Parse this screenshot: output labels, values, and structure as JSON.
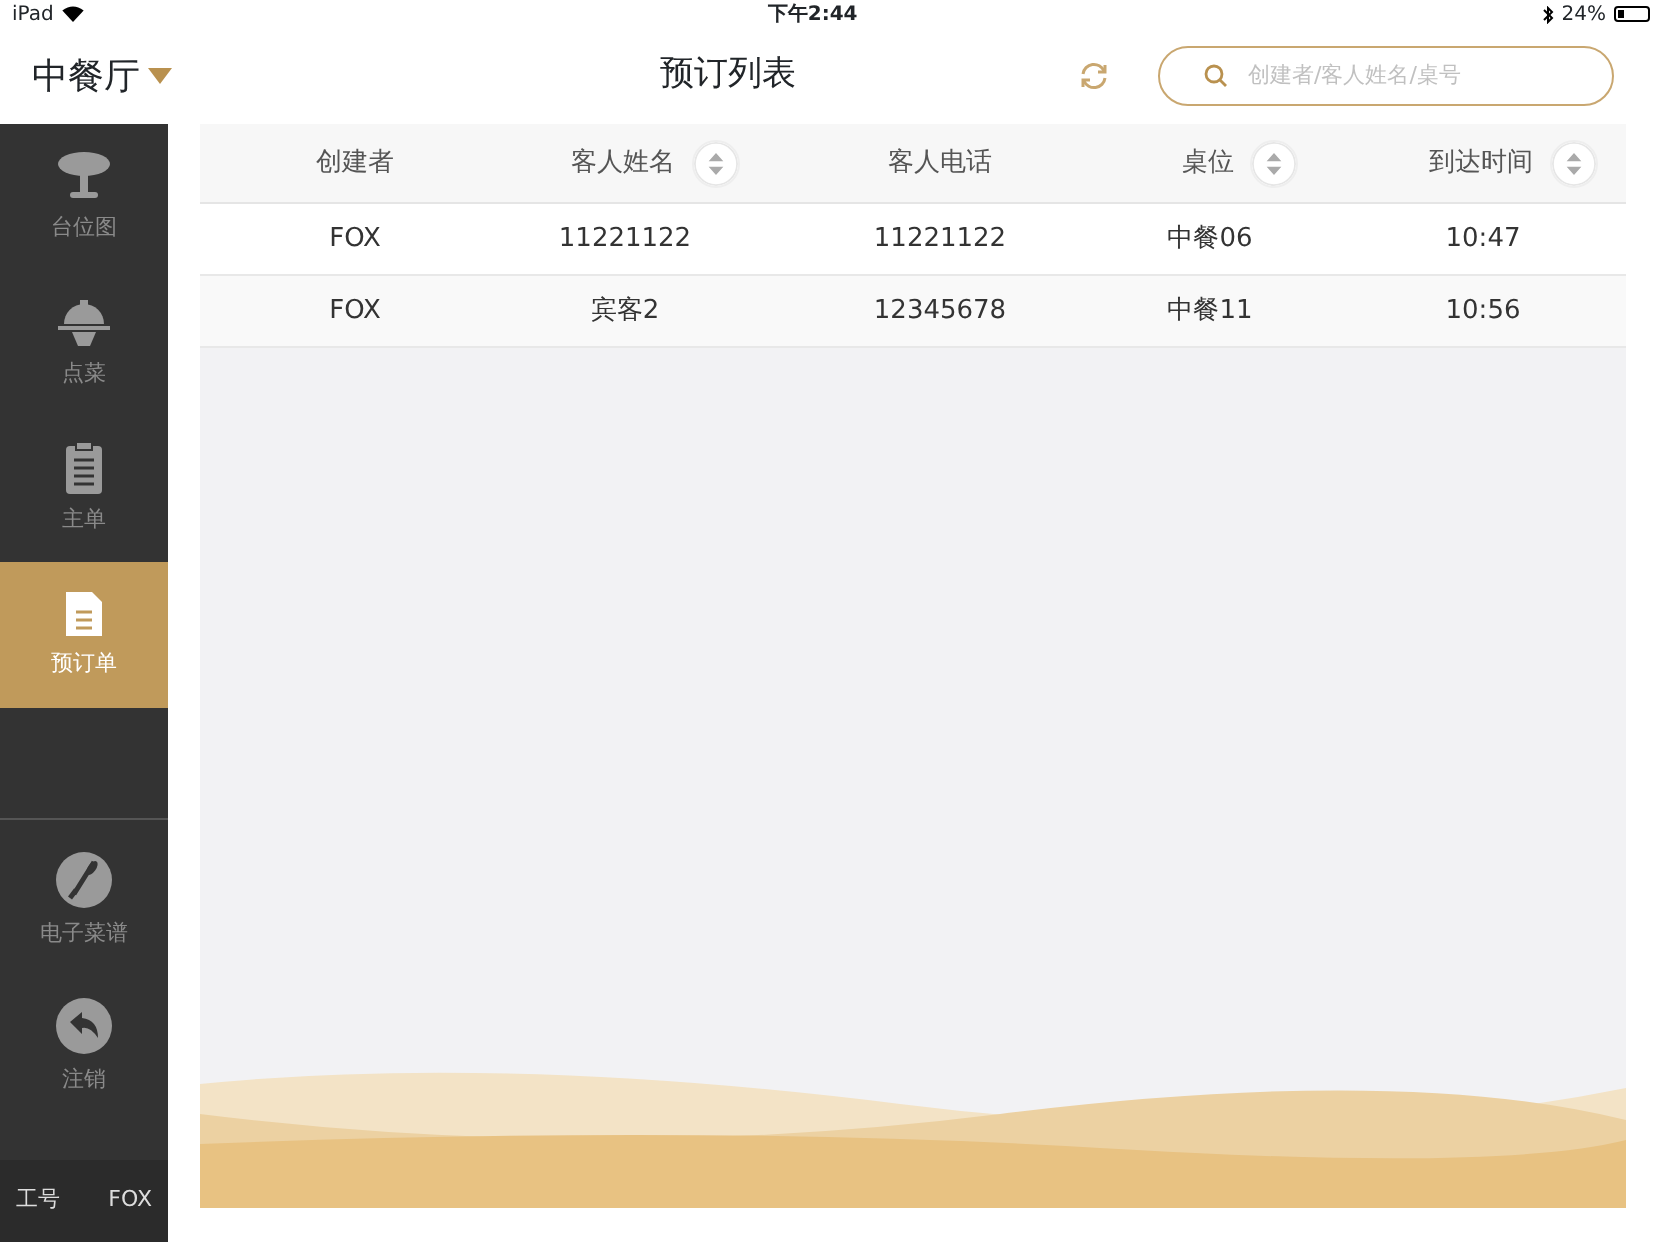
{
  "status_bar": {
    "device": "iPad",
    "time": "下午2:44",
    "battery": "24%"
  },
  "header": {
    "venue": "中餐厅",
    "title": "预订列表",
    "search": {
      "placeholder": "创建者/客人姓名/桌号"
    }
  },
  "sidebar": {
    "items": [
      {
        "label": "台位图",
        "kind": "table",
        "selected": false
      },
      {
        "label": "点菜",
        "kind": "cloche",
        "selected": false
      },
      {
        "label": "主单",
        "kind": "clipboard",
        "selected": false
      },
      {
        "label": "预订单",
        "kind": "document",
        "selected": true
      }
    ],
    "bottom_items": [
      {
        "label": "电子菜谱",
        "kind": "utensils"
      },
      {
        "label": "注销",
        "kind": "back"
      }
    ],
    "footer": {
      "label": "工号",
      "value": "FOX"
    }
  },
  "table": {
    "columns": [
      {
        "label": "创建者",
        "sortable": false
      },
      {
        "label": "客人姓名",
        "sortable": true
      },
      {
        "label": "客人电话",
        "sortable": false
      },
      {
        "label": "桌位",
        "sortable": true
      },
      {
        "label": "到达时间",
        "sortable": true
      }
    ],
    "rows": [
      [
        "FOX",
        "11221122",
        "11221122",
        "中餐06",
        "10:47"
      ],
      [
        "FOX",
        "宾客2",
        "12345678",
        "中餐11",
        "10:56"
      ]
    ]
  }
}
